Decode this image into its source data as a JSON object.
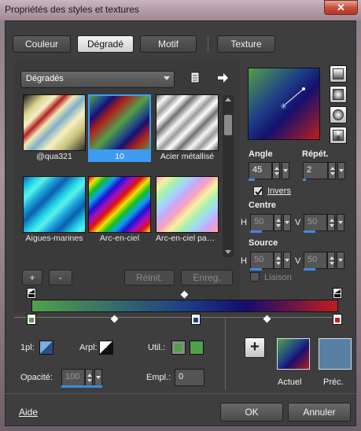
{
  "window": {
    "title": "Propriétés des styles et textures",
    "close_glyph": "✕"
  },
  "tabs": [
    {
      "label": "Couleur",
      "active": false
    },
    {
      "label": "Dégradé",
      "active": true
    },
    {
      "label": "Motif",
      "active": false
    },
    {
      "label": "Texture",
      "active": false
    }
  ],
  "library": {
    "category": "Dégradés",
    "thumbnails": [
      {
        "caption": "@qua321",
        "selected": false
      },
      {
        "caption": "10",
        "selected": true
      },
      {
        "caption": "Acier métallisé",
        "selected": false
      },
      {
        "caption": "Aigues-marines",
        "selected": false
      },
      {
        "caption": "Arc-en-ciel",
        "selected": false
      },
      {
        "caption": "Arc-en-ciel pastel",
        "selected": false
      }
    ],
    "buttons": {
      "add": "+",
      "remove": "-",
      "reset": "Réinit.",
      "save": "Enreg."
    }
  },
  "settings": {
    "angle_label": "Angle",
    "angle_value": "45",
    "repeat_label": "Répét.",
    "repeat_value": "2",
    "invert_label": "Invers",
    "invert_checked": true,
    "center_label": "Centre",
    "center_h": "50",
    "center_v": "50",
    "source_label": "Source",
    "source_h": "50",
    "source_v": "50",
    "link_label": "Liaison",
    "link_checked": false,
    "h_label": "H",
    "v_label": "V"
  },
  "gradient": {
    "stops": [
      {
        "color": "#52a04a",
        "pos": 0
      },
      {
        "color": "#1e3e86",
        "pos": 0.5
      },
      {
        "color": "#bf1e1e",
        "pos": 1
      }
    ]
  },
  "stop_settings": {
    "pl_label": "1pl:",
    "arpl_label": "Arpl:",
    "util_label": "Util.:",
    "opacity_label": "Opacité:",
    "opacity_value": "100",
    "empl_label": "Empl.:",
    "empl_value": "0"
  },
  "swatches": {
    "current_label": "Actuel",
    "previous_label": "Préc."
  },
  "footer": {
    "help": "Aide",
    "ok": "OK",
    "cancel": "Annuler"
  }
}
